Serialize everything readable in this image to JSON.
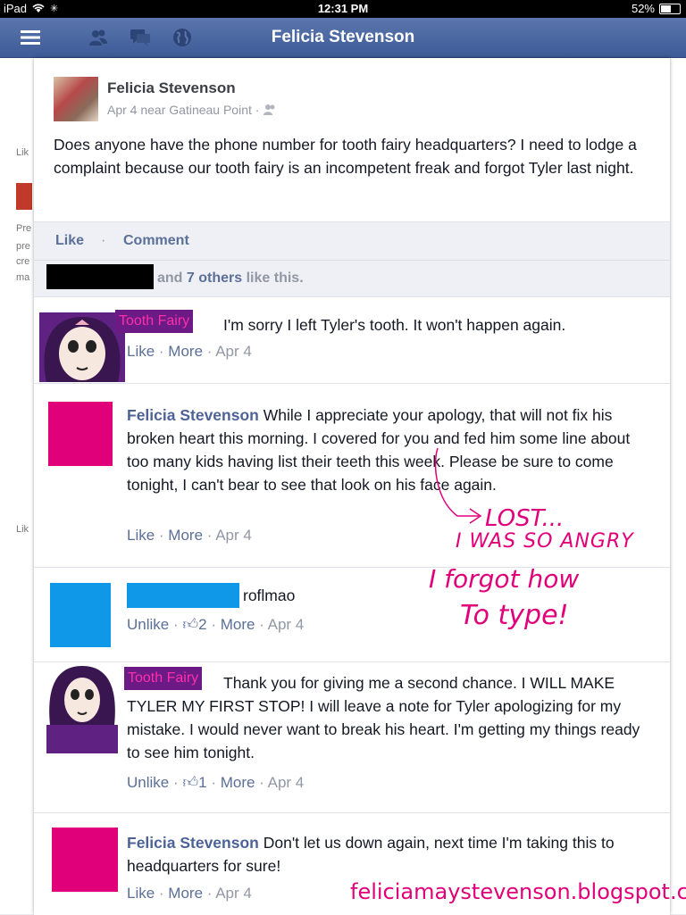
{
  "status_bar": {
    "device": "iPad",
    "time": "12:31 PM",
    "battery": "52%"
  },
  "nav": {
    "title": "Felicia Stevenson",
    "icons": [
      "menu-icon",
      "friends-icon",
      "messages-icon",
      "globe-icon"
    ]
  },
  "background": {
    "left_snippets": [
      "Lik",
      "Pre",
      "pre",
      "cre",
      "ma",
      "Lik"
    ]
  },
  "post": {
    "author": "Felicia Stevenson",
    "meta": "Apr 4 near Gatineau Point ·",
    "text": "Does anyone have the phone number for tooth fairy headquarters? I need to lodge a complaint because our tooth fairy is an incompetent freak and forgot Tyler last night.",
    "actions": {
      "like": "Like",
      "separator": "·",
      "comment": "Comment"
    },
    "likes": {
      "prefix": "and",
      "others": "7 others",
      "suffix": "like this."
    }
  },
  "comments": [
    {
      "name": "Tooth Fairy",
      "text": "I'm sorry I left Tyler's tooth. It won't happen again.",
      "actions": [
        "Like",
        "More",
        "Apr 4"
      ]
    },
    {
      "name": "Felicia Stevenson",
      "text": "While I appreciate your apology, that will not fix his broken heart this morning. I covered for you and fed him some line about too many kids having list their teeth this week. Please be sure to come tonight, I can't bear to see that look on his face again.",
      "actions": [
        "Like",
        "More",
        "Apr 4"
      ]
    },
    {
      "name": "",
      "text": "roflmao",
      "actions": [
        "Unlike",
        "2",
        "More",
        "Apr 4"
      ]
    },
    {
      "name": "Tooth Fairy",
      "text": "Thank you for giving me a second chance. I WILL MAKE TYLER MY FIRST STOP! I will leave a note for Tyler apologizing for my mistake. I would never want to break his heart. I'm getting my things ready to see him tonight.",
      "actions": [
        "Unlike",
        "1",
        "More",
        "Apr 4"
      ]
    },
    {
      "name": "Felicia Stevenson",
      "text": "Don't let us down again, next time I'm taking this to headquarters for sure!",
      "actions": [
        "Like",
        "More",
        "Apr 4"
      ]
    }
  ],
  "annotation": {
    "line1": "LOST...",
    "line2": "I WAS SO ANGRY",
    "line3": "I forgot how",
    "line4": "To type!"
  },
  "watermark": "feliciamaystevenson.blogspot.ca",
  "colors": {
    "nav_blue": "#3e5b98",
    "link_blue": "#5b6f97",
    "name_blue": "#4d6397",
    "pink": "#e0007a",
    "purple": "#6b1a86",
    "redact_blue": "#1098e8"
  }
}
